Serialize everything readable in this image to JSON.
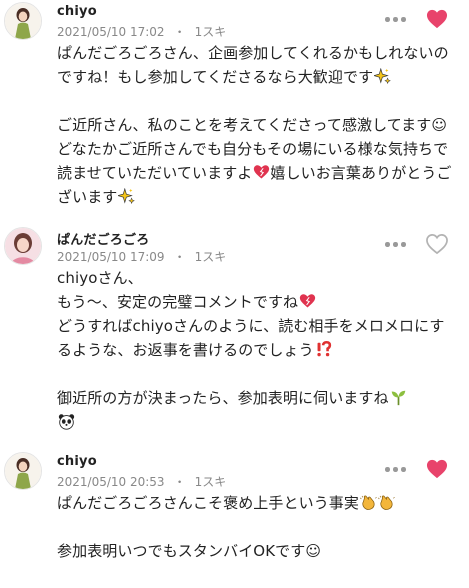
{
  "comments": [
    {
      "author": "chiyo",
      "date": "2021/05/10 17:02",
      "likes": "1スキ",
      "liked": true,
      "avatar_icon": "avatar-green-dress-icon",
      "paragraphs": [
        [
          {
            "text": "ぱんだごろごろさん、企画参加してくれるかもしれないのですね！もし参加してくださるなら大歓迎です"
          },
          {
            "emoji": "sparkles-emoji"
          }
        ],
        [
          {
            "text": "ご近所さん、私のことを考えてくださって感激してます☺どなたかご近所さんでも自分もその場にいる様な気持ちで読ませていただいていますよ"
          },
          {
            "emoji": "heart-emoji"
          },
          {
            "text": "嬉しいお言葉ありがとうございます"
          },
          {
            "emoji": "sparkles-emoji"
          }
        ]
      ]
    },
    {
      "author": "ぱんだごろごろ",
      "date": "2021/05/10 17:09",
      "likes": "1スキ",
      "liked": false,
      "avatar_icon": "avatar-pink-portrait-icon",
      "paragraphs": [
        [
          {
            "text": "chiyoさん、\nもう～、安定の完璧コメントですね"
          },
          {
            "emoji": "heart-emoji"
          },
          {
            "text": "\nどうすればchiyoさんのように、読む相手をメロメロにするような、お返事を書けるのでしょう"
          },
          {
            "emoji": "exclamation-question-emoji"
          }
        ],
        [
          {
            "text": "御近所の方が決まったら、参加表明に伺いますね"
          },
          {
            "emoji": "seedling-emoji"
          },
          {
            "text": "\n"
          },
          {
            "emoji": "panda-emoji"
          }
        ]
      ]
    },
    {
      "author": "chiyo",
      "date": "2021/05/10 20:53",
      "likes": "1スキ",
      "liked": true,
      "avatar_icon": "avatar-green-dress-icon",
      "paragraphs": [
        [
          {
            "text": "ぱんだごろごろさんこそ褒め上手という事実"
          },
          {
            "emoji": "clapping-hands-emoji"
          },
          {
            "emoji": "clapping-hands-emoji"
          }
        ],
        [
          {
            "text": "参加表明いつでもスタンバイOKです☺"
          }
        ]
      ]
    }
  ],
  "colors": {
    "heart_liked": "#e8436b",
    "heart_outline": "#b3b3b3",
    "meta_text": "#888888",
    "dots": "#999999"
  }
}
